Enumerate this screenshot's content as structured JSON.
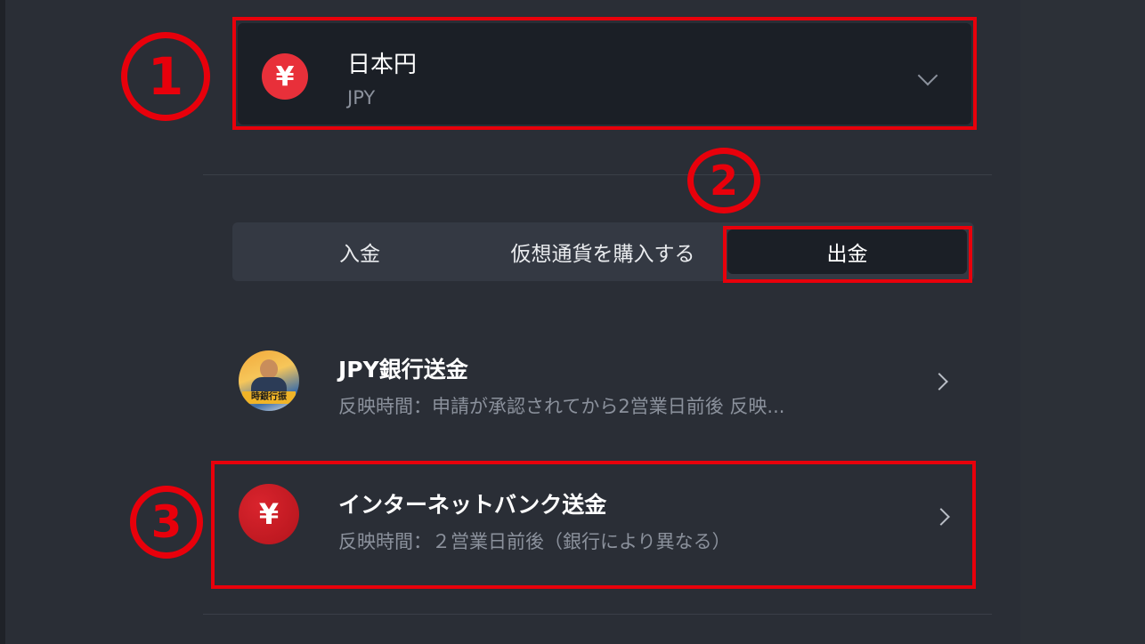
{
  "currency": {
    "symbol": "¥",
    "name": "日本円",
    "code": "JPY"
  },
  "tabs": [
    {
      "label": "入金"
    },
    {
      "label": "仮想通貨を購入する"
    },
    {
      "label": "出金",
      "active": true
    }
  ],
  "methods": [
    {
      "title": "JPY銀行送金",
      "subtitle": "反映時間：申請が承認されてから2営業日前後 反映...",
      "icon_banner": "時銀行振"
    },
    {
      "title": "インターネットバンク送金",
      "subtitle": "反映時間：２営業日前後（銀行により異なる）",
      "icon_symbol": "¥"
    }
  ],
  "annotations": [
    "①",
    "②",
    "③"
  ],
  "colors": {
    "annotation_red": "#e8000b",
    "yen_badge": "#e8303a",
    "background": "#2a2e36"
  }
}
